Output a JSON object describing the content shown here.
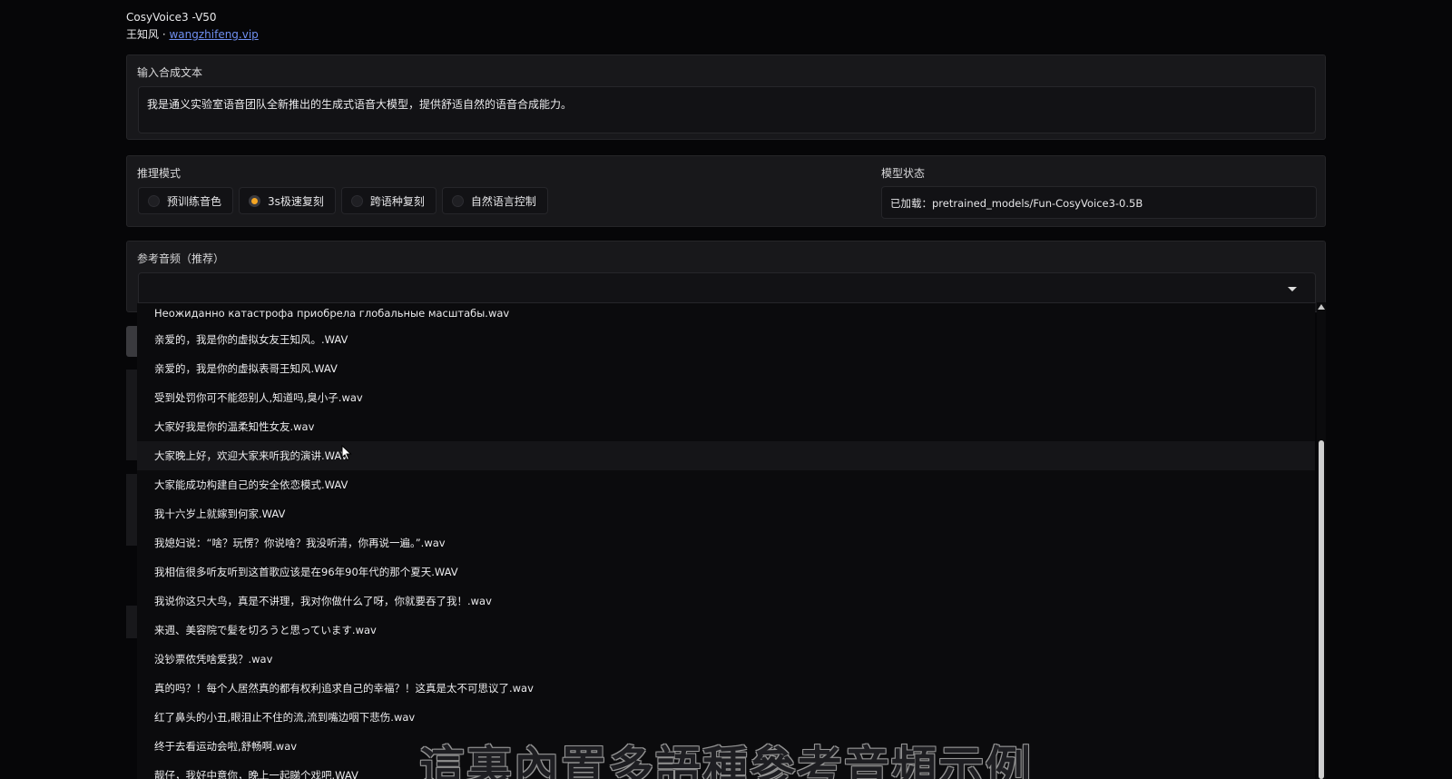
{
  "header": {
    "title": "CosyVoice3 -V50",
    "author": "王知风",
    "separator": " · ",
    "link": "wangzhifeng.vip"
  },
  "text_input": {
    "label": "输入合成文本",
    "value": "我是通义实验室语音团队全新推出的生成式语音大模型，提供舒适自然的语音合成能力。"
  },
  "inference": {
    "label": "推理模式",
    "options": [
      "预训练音色",
      "3s极速复刻",
      "跨语种复刻",
      "自然语言控制"
    ],
    "selected": "3s极速复刻"
  },
  "model_status": {
    "label": "模型状态",
    "value": "已加载：pretrained_models/Fun-CosyVoice3-0.5B"
  },
  "reference_audio": {
    "label": "参考音频（推荐）",
    "value": "",
    "options": [
      "Неожиданно катастрофа приобрела глобальные масштабы.wav",
      "亲爱的，我是你的虚拟女友王知风。.WAV",
      "亲爱的，我是你的虚拟表哥王知风.WAV",
      "受到处罚你可不能怨别人,知道吗,臭小子.wav",
      "大家好我是你的温柔知性女友.wav",
      "大家晚上好，欢迎大家来听我的演讲.WAV",
      "大家能成功构建自己的安全依恋模式.WAV",
      "我十六岁上就嫁到何家.WAV",
      "我媳妇说：“啥？玩愣？你说啥？我没听清，你再说一遍。”.wav",
      "我相信很多听友听到这首歌应该是在96年90年代的那个夏天.WAV",
      "我说你这只大鸟，真是不讲理，我对你做什么了呀，你就要吞了我！.wav",
      "来週、美容院で髪を切ろうと思っています.wav",
      "没钞票侬凭啥爱我？.wav",
      "真的吗？！每个人居然真的都有权利追求自己的幸福？！这真是太不可思议了.wav",
      "红了鼻头的小丑,眼泪止不住的流,流到嘴边咽下悲伤.wav",
      "终于去看运动会啦,舒畅啊.wav",
      "靓仔，我好中意你，晚上一起睇个戏吧.WAV"
    ],
    "hovered_index": 5
  },
  "subtitle": "這裏內置多語種參考音頻示例"
}
